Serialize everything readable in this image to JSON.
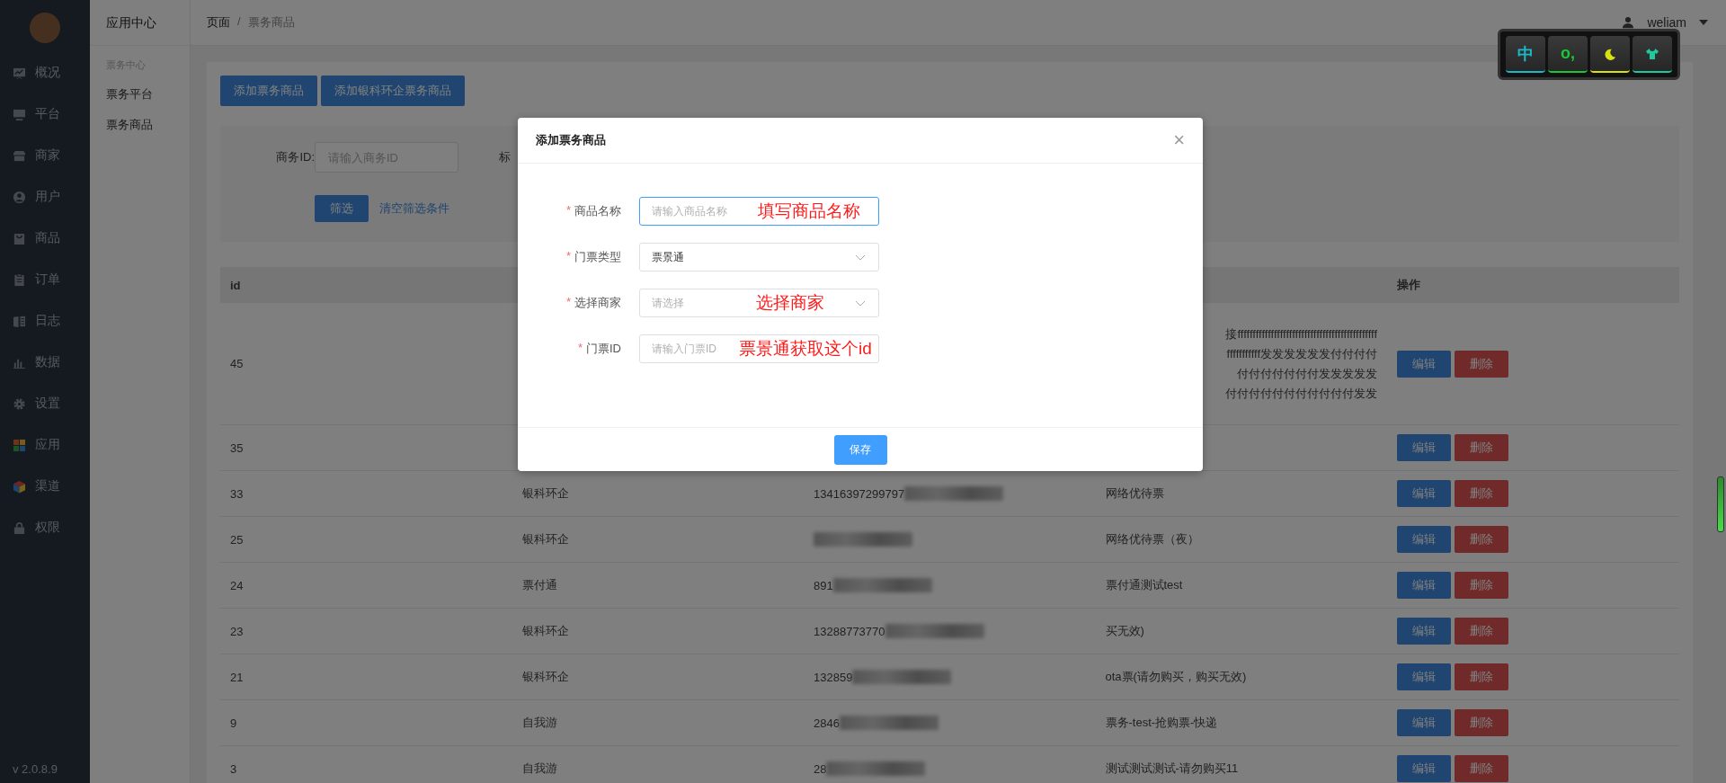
{
  "sidebar": {
    "items": [
      {
        "label": "概况"
      },
      {
        "label": "平台"
      },
      {
        "label": "商家"
      },
      {
        "label": "用户"
      },
      {
        "label": "商品"
      },
      {
        "label": "订单"
      },
      {
        "label": "日志"
      },
      {
        "label": "数据"
      },
      {
        "label": "设置"
      },
      {
        "label": "应用"
      },
      {
        "label": "渠道"
      },
      {
        "label": "权限"
      }
    ],
    "version": "v 2.0.8.9"
  },
  "submenu": {
    "title": "应用中心",
    "group": "票务中心",
    "items": [
      {
        "label": "票务平台"
      },
      {
        "label": "票务商品"
      }
    ]
  },
  "header": {
    "breadcrumb": [
      "页面",
      "票务商品"
    ],
    "separator": "/",
    "user": "weliam"
  },
  "toolbar": {
    "buttons": [
      "添加票务商品",
      "添加银科环企票务商品"
    ]
  },
  "filter": {
    "business_id_label": "商务ID:",
    "business_id_placeholder": "请输入商务ID",
    "title_label": "标",
    "filter_button": "筛选",
    "clear_link": "清空筛选条件"
  },
  "table": {
    "column_headers": {
      "column_1": "id",
      "column_5": "操作"
    },
    "rows": [
      {
        "id": "45",
        "column_4": [
          "接ffffffffffffffffffffffffffffffffffffffffffffff",
          "fffffffffff发发发发发发付付付付",
          "付付付付付付付发发发发发",
          "付付付付付付付付付付付发发"
        ],
        "edit": "编辑",
        "delete": "删除"
      },
      {
        "id": "35",
        "edit": "编辑",
        "delete": "删除"
      },
      {
        "id": "33",
        "column_2": "银科环企",
        "column_3": "13416397299797",
        "column_3_blurred": true,
        "column_4": "网络优待票",
        "edit": "编辑",
        "delete": "删除"
      },
      {
        "id": "25",
        "column_2": "银科环企",
        "column_3_blurred": true,
        "column_4": "网络优待票（夜）",
        "edit": "编辑",
        "delete": "删除"
      },
      {
        "id": "24",
        "column_2": "票付通",
        "column_3": "891",
        "column_3_blurred": true,
        "column_4": "票付通测试test",
        "edit": "编辑",
        "delete": "删除"
      },
      {
        "id": "23",
        "column_2": "银科环企",
        "column_3": "13288773770",
        "column_3_blurred": true,
        "column_4": "买无效)",
        "edit": "编辑",
        "delete": "删除"
      },
      {
        "id": "21",
        "column_2": "银科环企",
        "column_3": "132859",
        "column_3_blurred": true,
        "column_4": "ota票(请勿购买，购买无效)",
        "edit": "编辑",
        "delete": "删除"
      },
      {
        "id": "9",
        "column_2": "自我游",
        "column_3": "2846",
        "column_3_blurred": true,
        "column_4": "票务-test-抢购票-快递",
        "edit": "编辑",
        "delete": "删除"
      },
      {
        "id": "3",
        "column_2": "自我游",
        "column_3": "28",
        "column_3_blurred": true,
        "column_4": "测试测试测试-请勿购买11",
        "edit": "编辑",
        "delete": "删除"
      }
    ]
  },
  "modal": {
    "title": "添加票务商品",
    "close": "×",
    "fields": [
      {
        "kind": "input",
        "required_mark": "*",
        "label": "商品名称",
        "placeholder": "请输入商品名称",
        "focused": true,
        "annotation": "填写商品名称"
      },
      {
        "kind": "select",
        "required_mark": "*",
        "label": "门票类型",
        "value": "票景通",
        "focused": false
      },
      {
        "kind": "select",
        "required_mark": "*",
        "label": "选择商家",
        "placeholder": "请选择",
        "focused": false,
        "annotation": "选择商家"
      },
      {
        "kind": "input",
        "required_mark": "*",
        "label": "门票ID",
        "placeholder": "请输入门票ID",
        "focused": false,
        "annotation": "票景通获取这个id"
      }
    ],
    "save": "保存"
  },
  "ime": {
    "keys": [
      {
        "kind": "text",
        "label": "中",
        "color": "#1ab8c8"
      },
      {
        "kind": "text",
        "label": "o,",
        "color": "#19c832"
      },
      {
        "kind": "moon",
        "color": "#d8e010"
      },
      {
        "kind": "shirt",
        "color": "#20c8a0"
      }
    ]
  }
}
